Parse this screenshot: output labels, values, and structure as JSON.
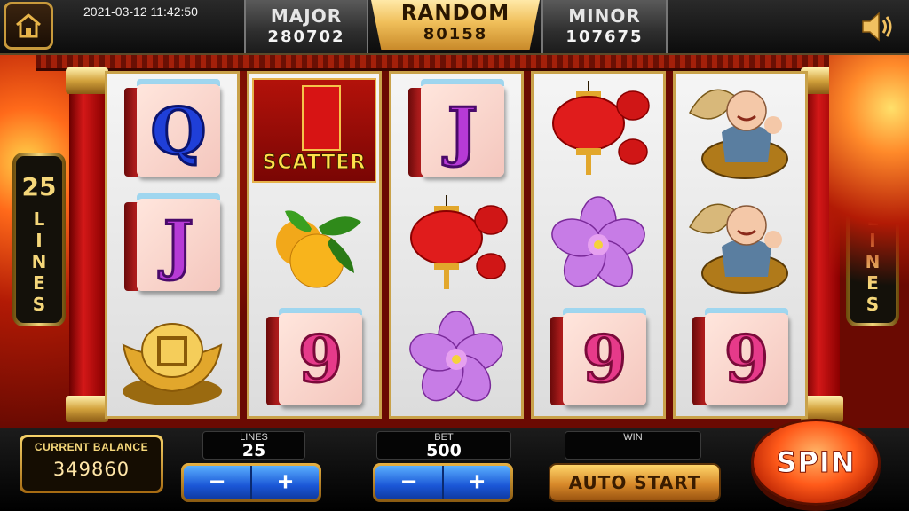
{
  "datetime": "2021-03-12 11:42:50",
  "jackpots": {
    "major": {
      "label": "MAJOR",
      "value": "280702"
    },
    "random": {
      "label": "RANDOM",
      "value": "80158"
    },
    "minor": {
      "label": "MINOR",
      "value": "107675"
    }
  },
  "paylines": {
    "count": "25",
    "word": "LINES"
  },
  "reels": [
    [
      "Q",
      "J",
      "gold-ingot"
    ],
    [
      "scatter",
      "oranges",
      "9"
    ],
    [
      "J",
      "lanterns",
      "plum-blossom"
    ],
    [
      "lanterns",
      "plum-blossom",
      "9"
    ],
    [
      "god-of-wealth",
      "god-of-wealth",
      "9"
    ]
  ],
  "scatter_label": "SCATTER",
  "balance": {
    "label": "CURRENT BALANCE",
    "value": "349860"
  },
  "lines_ctl": {
    "label": "LINES",
    "value": "25",
    "minus": "−",
    "plus": "+"
  },
  "bet_ctl": {
    "label": "BET",
    "value": "500",
    "minus": "−",
    "plus": "+"
  },
  "win_ctl": {
    "label": "WIN",
    "value": ""
  },
  "autostart_label": "AUTO START",
  "spin_label": "SPIN",
  "icons": {
    "home": "home-icon",
    "sound": "speaker-icon"
  }
}
